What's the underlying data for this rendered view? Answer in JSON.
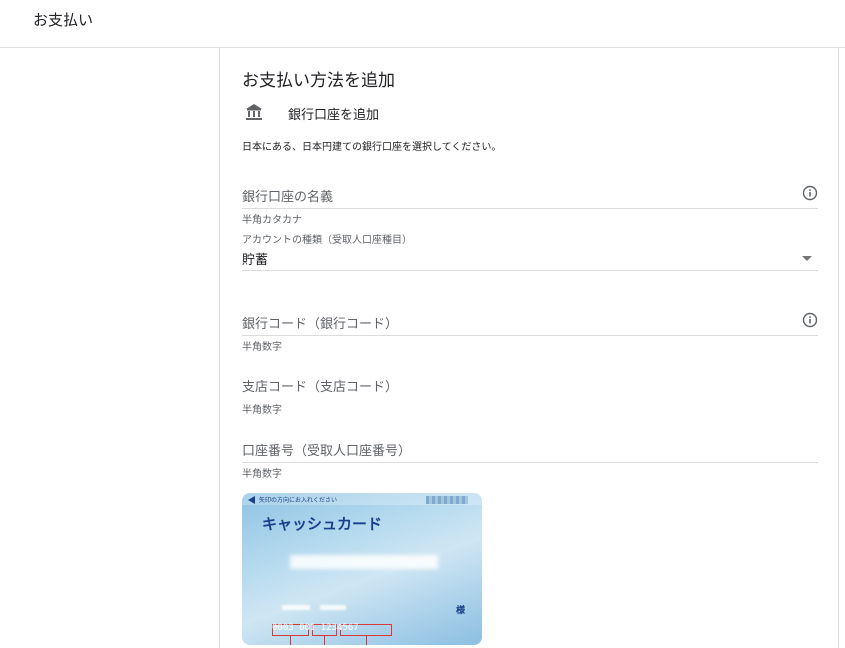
{
  "header": {
    "title": "お支払い"
  },
  "panel": {
    "section_title": "お支払い方法を追加",
    "bank_option_label": "銀行口座を追加",
    "description": "日本にある、日本円建ての銀行口座を選択してください。",
    "fields": {
      "account_name": {
        "label": "銀行口座の名義",
        "hint": "半角カタカナ"
      },
      "account_type": {
        "caption": "アカウントの種類（受取人口座種目）",
        "value": "貯蓄"
      },
      "bank_code": {
        "label": "銀行コード（銀行コード）",
        "hint": "半角数字"
      },
      "branch_code": {
        "label": "支店コード（支店コード）",
        "hint": "半角数字"
      },
      "account_number": {
        "label": "口座番号（受取人口座番号）",
        "hint": "半角数字"
      }
    },
    "card_example": {
      "instruction": "矢印の方向にお入れください",
      "title": "キャッシュカード",
      "sama": "様",
      "number_text": "0003  001  1234567"
    }
  },
  "icons": {
    "bank": "bank-icon",
    "info": "info-icon",
    "dropdown": "dropdown-arrow-icon"
  },
  "colors": {
    "label_gray": "#5f6368",
    "divider": "#dadce0",
    "text": "#202124",
    "card_blue": "#1a3f8a"
  }
}
